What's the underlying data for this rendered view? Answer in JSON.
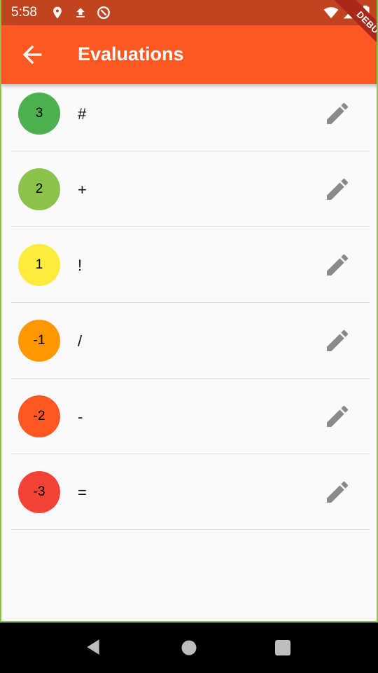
{
  "status_bar": {
    "time": "5:58",
    "icons": [
      "location-icon",
      "upload-icon",
      "data-saver-icon",
      "wifi-icon",
      "signal-icon",
      "battery-icon"
    ]
  },
  "app_bar": {
    "title": "Evaluations",
    "back_icon": "arrow-back-icon",
    "color": "#ff5722"
  },
  "debug_banner": "DEBUG",
  "evaluations": [
    {
      "value": "3",
      "symbol": "#",
      "color": "#4caf50"
    },
    {
      "value": "2",
      "symbol": "+",
      "color": "#8bc34a"
    },
    {
      "value": "1",
      "symbol": "!",
      "color": "#ffeb3b"
    },
    {
      "value": "-1",
      "symbol": "/",
      "color": "#ff9800"
    },
    {
      "value": "-2",
      "symbol": "-",
      "color": "#ff5722"
    },
    {
      "value": "-3",
      "symbol": "=",
      "color": "#f44336"
    }
  ],
  "navigation_bar": {
    "icons": [
      "nav-back-icon",
      "nav-home-icon",
      "nav-recents-icon"
    ]
  }
}
